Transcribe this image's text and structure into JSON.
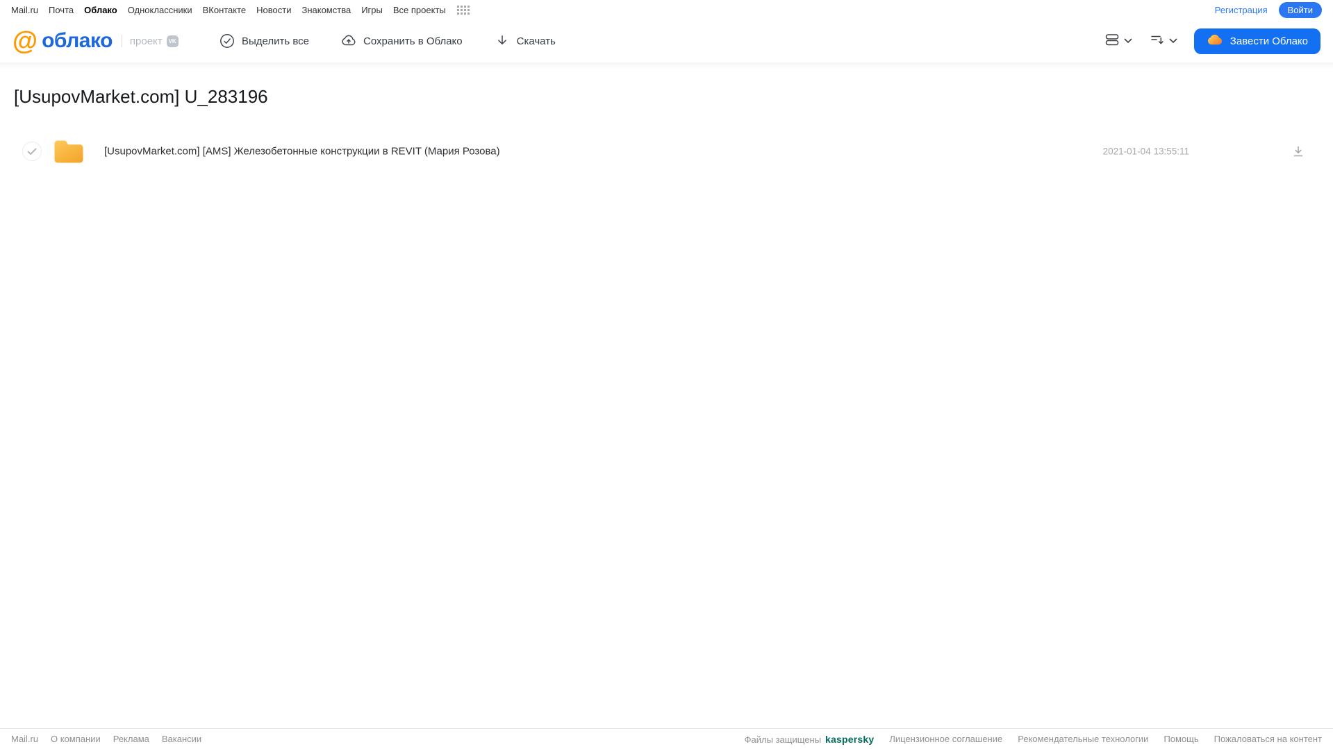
{
  "top_nav": {
    "links": [
      "Mail.ru",
      "Почта",
      "Облако",
      "Одноклассники",
      "ВКонтакте",
      "Новости",
      "Знакомства",
      "Игры",
      "Все проекты"
    ],
    "active_link": "Облако",
    "register_label": "Регистрация",
    "login_label": "Войти"
  },
  "header": {
    "logo_at": "@",
    "logo_text": "облако",
    "project_label": "проект",
    "vk_badge_label": "VK",
    "toolbar": {
      "select_all_label": "Выделить все",
      "save_to_cloud_label": "Сохранить в Облако",
      "download_label": "Скачать"
    },
    "cta_label": "Завести Облако"
  },
  "main": {
    "title": "[UsupovMarket.com] U_283196",
    "files": [
      {
        "type": "folder",
        "name": "[UsupovMarket.com] [AMS] Железобетонные конструкции в REVIT (Мария Розова)",
        "date": "2021-01-04 13:55:11"
      }
    ]
  },
  "footer": {
    "left_links": [
      "Mail.ru",
      "О компании",
      "Реклама",
      "Вакансии"
    ],
    "protected_text": "Файлы защищены",
    "kaspersky_label": "kaspersky",
    "right_links": [
      "Лицензионное соглашение",
      "Рекомендательные технологии",
      "Помощь",
      "Пожаловаться на контент"
    ]
  },
  "icons": {
    "apps": "grid-dots-icon",
    "select_all": "check-circle-icon",
    "save_to_cloud": "cloud-upload-icon",
    "download": "download-arrow-icon",
    "view_mode": "list-view-icon",
    "sort": "sort-down-icon",
    "chevron": "chevron-down-icon",
    "cta_cloud": "cloud-icon",
    "folder": "folder-icon",
    "row_download": "download-underline-icon",
    "vk": "vk-badge-icon",
    "logo_at": "at-sign-icon",
    "row_check": "checkmark-circle-icon"
  },
  "colors": {
    "accent_blue": "#1470f3",
    "link_blue": "#2b77f3",
    "logo_blue": "#1e68d9",
    "logo_orange": "#ff9900",
    "folder_gradient_top": "#ffc95a",
    "folder_gradient_bottom": "#f3a72e",
    "kaspersky_teal": "#006d5c",
    "muted_gray": "#a9a9a9"
  }
}
